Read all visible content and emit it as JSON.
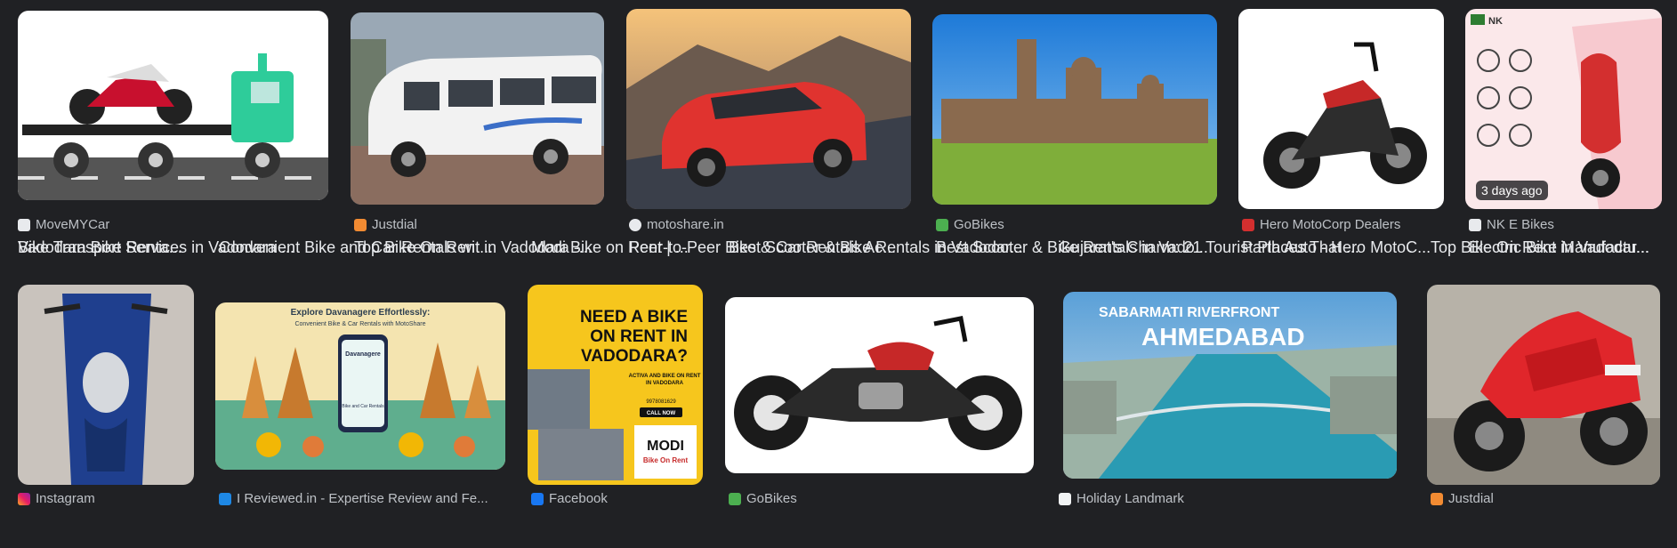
{
  "results": [
    {
      "source": "MoveMYCar",
      "title": "Bike Transport Services in Vadodara ..."
    },
    {
      "source": "Justdial",
      "title": "Top Bike On Rent in Vadodara -..."
    },
    {
      "source": "motoshare.in",
      "title": "Peer-to-Peer Bike & Car Rentals Ac..."
    },
    {
      "source": "GoBikes",
      "title": "Best Scooter & Bike Rentals in Vado..."
    },
    {
      "source": "Hero MotoCorp Dealers",
      "title": "Parth Auto - Hero MotoC..."
    },
    {
      "source": "NK E Bikes",
      "title": "Electric Bike Manufactu...",
      "badge": "3 days ago",
      "logo_text": "NK"
    },
    {
      "source": "Instagram",
      "title": "Vadodara Bike Renta..."
    },
    {
      "source": "I Reviewed.in - Expertise Review and Fe...",
      "title": "Convenient Bike and Car Rentals wit...",
      "img_title": "Explore Davanagere Effortlessly:",
      "img_sub": "Convenient Bike & Car Rentals with MotoShare",
      "img_city": "Davanagere",
      "img_app": "Bike and Car Rentals"
    },
    {
      "source": "Facebook",
      "title": "Modi Bike on Rent | ...",
      "ad_l1": "NEED A BIKE",
      "ad_l2": "ON RENT IN",
      "ad_l3": "VADODARA?",
      "ad_sub1": "ACTIVA AND BIKE ON RENT",
      "ad_sub2": "IN VADODARA",
      "ad_phone": "9978081629",
      "ad_call": "CALL NOW",
      "ad_brand": "MODI",
      "ad_brand_sub": "Bike On Rent"
    },
    {
      "source": "GoBikes",
      "title": "Best Scooter & Bike Rentals in Vadodar..."
    },
    {
      "source": "Holiday Landmark",
      "title": "Gujarat's Charm: 21 Tourist Places That ...",
      "img_l1": "SABARMATI RIVERFRONT",
      "img_l2": "AHMEDABAD"
    },
    {
      "source": "Justdial",
      "title": "Top Bike On Rent in Vadodar..."
    }
  ],
  "colors": {
    "background": "#202124",
    "source_text": "#bdc1c6",
    "title_text": "#e8eaed"
  }
}
